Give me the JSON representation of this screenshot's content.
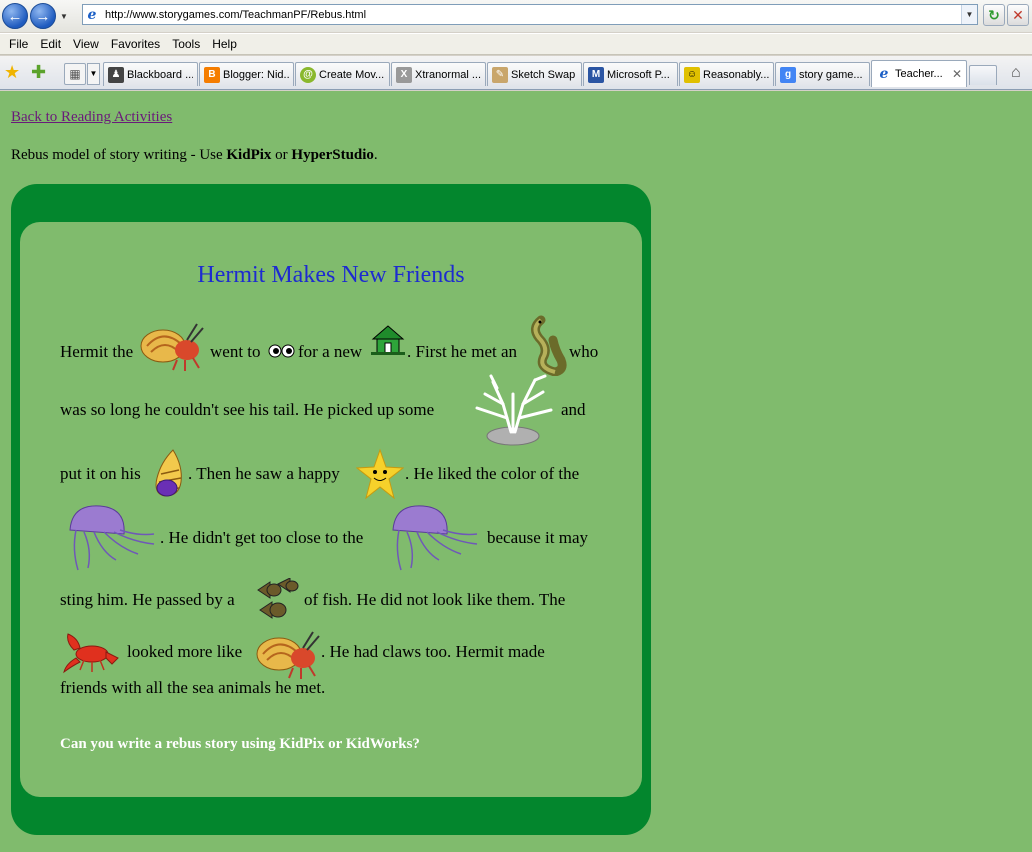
{
  "browser": {
    "url": "http://www.storygames.com/TeachmanPF/Rebus.html",
    "menu": [
      "File",
      "Edit",
      "View",
      "Favorites",
      "Tools",
      "Help"
    ],
    "tabs": [
      {
        "label": "Blackboard ...",
        "icon": "blackboard-icon",
        "color": "#444444"
      },
      {
        "label": "Blogger: Nid...",
        "icon": "blogger-icon",
        "color": "#f57d00"
      },
      {
        "label": "Create Mov...",
        "icon": "spiral-icon",
        "color": "#8ab82d"
      },
      {
        "label": "Xtranormal ...",
        "icon": "x-icon",
        "color": "#777777"
      },
      {
        "label": "Sketch Swap",
        "icon": "sketch-icon",
        "color": "#c9a66b"
      },
      {
        "label": "Microsoft P...",
        "icon": "microsoft-icon",
        "color": "#2b55a3"
      },
      {
        "label": "Reasonably...",
        "icon": "robot-icon",
        "color": "#e0c000"
      },
      {
        "label": "story game...",
        "icon": "google-icon",
        "color": "#4285f4"
      },
      {
        "label": "Teacher...",
        "icon": "ie-icon",
        "color": "#1b5fc6"
      }
    ]
  },
  "page": {
    "back_link": "Back to Reading Activities",
    "intro_prefix": "Rebus model of story writing - Use ",
    "intro_kidpix": "KidPix",
    "intro_or": " or ",
    "intro_hyperstudio": "HyperStudio",
    "intro_end": ".",
    "title": "Hermit Makes New Friends",
    "lines": [
      "Hermit the",
      "went to",
      "for a new",
      ". First he met an",
      "who",
      "was so long he couldn't see his tail. He picked up some",
      "and",
      "put it on his",
      ". Then he saw a happy",
      ". He liked the color of the",
      ". He didn't get too close to the",
      "because it may",
      "sting him. He passed by a",
      "of fish. He did not look like them. The",
      "looked more like",
      ". He had claws too. Hermit made",
      "friends with all the sea animals he met."
    ],
    "question": "Can you write a rebus story using KidPix or KidWorks?"
  },
  "colors": {
    "page_bg": "#80bb6d",
    "card_border": "#03862d",
    "title": "#1d2bd0",
    "link": "#6a1a7a"
  }
}
